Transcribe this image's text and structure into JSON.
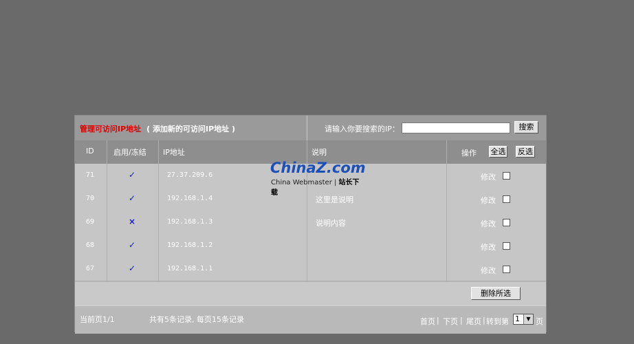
{
  "header_bar": {
    "title": "管理可访问IP地址",
    "add_link": "( 添加新的可访问IP地址 )",
    "search_label": "请输入你要搜索的IP：",
    "search_value": "",
    "search_button": "搜索"
  },
  "table": {
    "columns": {
      "id": "ID",
      "status": "启用/冻结",
      "ip": "IP地址",
      "desc": "说明",
      "ops": "操作",
      "select_all": "全选",
      "invert": "反选"
    },
    "rows": [
      {
        "id": "71",
        "status": "✓",
        "ip": "27.37.209.6",
        "desc": "",
        "edit": "修改"
      },
      {
        "id": "70",
        "status": "✓",
        "ip": "192.168.1.4",
        "desc": "这里是说明",
        "edit": "修改"
      },
      {
        "id": "69",
        "status": "×",
        "ip": "192.168.1.3",
        "desc": "说明内容",
        "edit": "修改"
      },
      {
        "id": "68",
        "status": "✓",
        "ip": "192.168.1.2",
        "desc": "",
        "edit": "修改"
      },
      {
        "id": "67",
        "status": "✓",
        "ip": "192.168.1.1",
        "desc": "",
        "edit": "修改"
      }
    ],
    "delete_selected": "删除所选"
  },
  "footer": {
    "current_page": "当前页1/1",
    "summary": "共有5条记录, 每页15条记录",
    "first": "首页",
    "prev": "下页",
    "last": "尾页",
    "goto": "转到第",
    "page_value": "1",
    "page_suffix": "页",
    "divider": "|"
  },
  "watermark": {
    "logo": "ChinaZ.com",
    "sub_en": "China Webmaster",
    "sub_cn": "站长下载"
  },
  "colors": {
    "background": "#6a6a6a",
    "title_red": "#e00000",
    "check_blue": "#1a1acc"
  }
}
